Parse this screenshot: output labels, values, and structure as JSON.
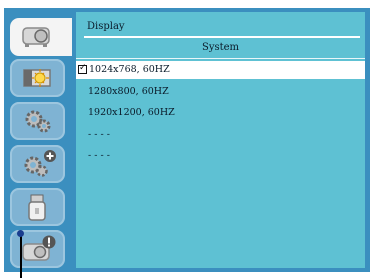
{
  "header": {
    "title": "Display"
  },
  "submenu": {
    "title": "System"
  },
  "resolutions": [
    {
      "label": "1024x768, 60HZ",
      "selected": true
    },
    {
      "label": "1280x800, 60HZ",
      "selected": false
    },
    {
      "label": "1920x1200, 60HZ",
      "selected": false
    },
    {
      "label": "- - - -",
      "selected": false
    },
    {
      "label": "- - - -",
      "selected": false
    }
  ],
  "sidebar": {
    "items": [
      {
        "icon": "display-icon",
        "active": true
      },
      {
        "icon": "picture-adjust-icon",
        "active": false
      },
      {
        "icon": "setting-gear-icon",
        "active": false
      },
      {
        "icon": "expanded-setting-icon",
        "active": false
      },
      {
        "icon": "usb-memory-icon",
        "active": false
      },
      {
        "icon": "info-icon",
        "active": false
      }
    ]
  },
  "colors": {
    "frame": "#3b8fbf",
    "panel": "#5ec1d3",
    "selected_row": "#ffffff"
  }
}
